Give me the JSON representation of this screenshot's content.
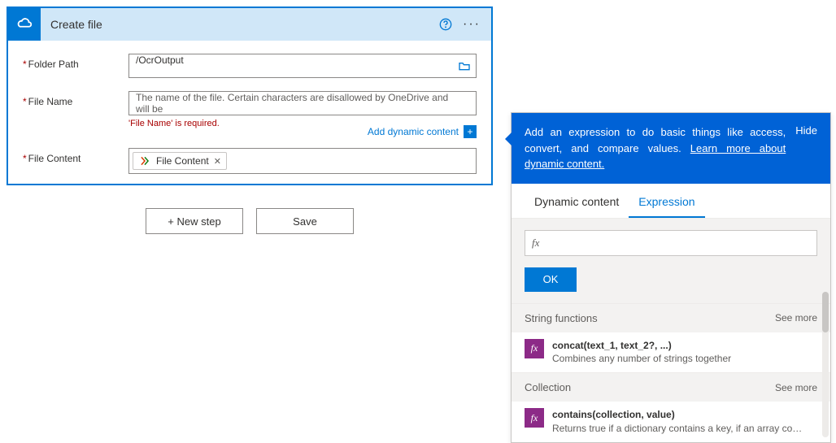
{
  "card": {
    "title": "Create file",
    "fields": {
      "folderPath": {
        "label": "Folder Path",
        "value": "/OcrOutput"
      },
      "fileName": {
        "label": "File Name",
        "placeholder": "The name of the file. Certain characters are disallowed by OneDrive and will be",
        "error": "'File Name' is required."
      },
      "fileContent": {
        "label": "File Content",
        "tokenText": "File Content"
      }
    },
    "addDynamic": "Add dynamic content"
  },
  "buttons": {
    "newStep": "+ New step",
    "save": "Save"
  },
  "flyout": {
    "banner": {
      "pre": "Add an expression to do basic things like access, convert, and compare values. ",
      "link": "Learn more about dynamic content.",
      "hide": "Hide"
    },
    "tabs": {
      "dynamic": "Dynamic content",
      "expression": "Expression"
    },
    "fx_placeholder": "fx",
    "ok": "OK",
    "sections": [
      {
        "title": "String functions",
        "seeMore": "See more",
        "items": [
          {
            "sig": "concat(text_1, text_2?, ...)",
            "desc": "Combines any number of strings together"
          }
        ]
      },
      {
        "title": "Collection",
        "seeMore": "See more",
        "items": [
          {
            "sig": "contains(collection, value)",
            "desc": "Returns true if a dictionary contains a key, if an array cont..."
          }
        ]
      }
    ]
  }
}
